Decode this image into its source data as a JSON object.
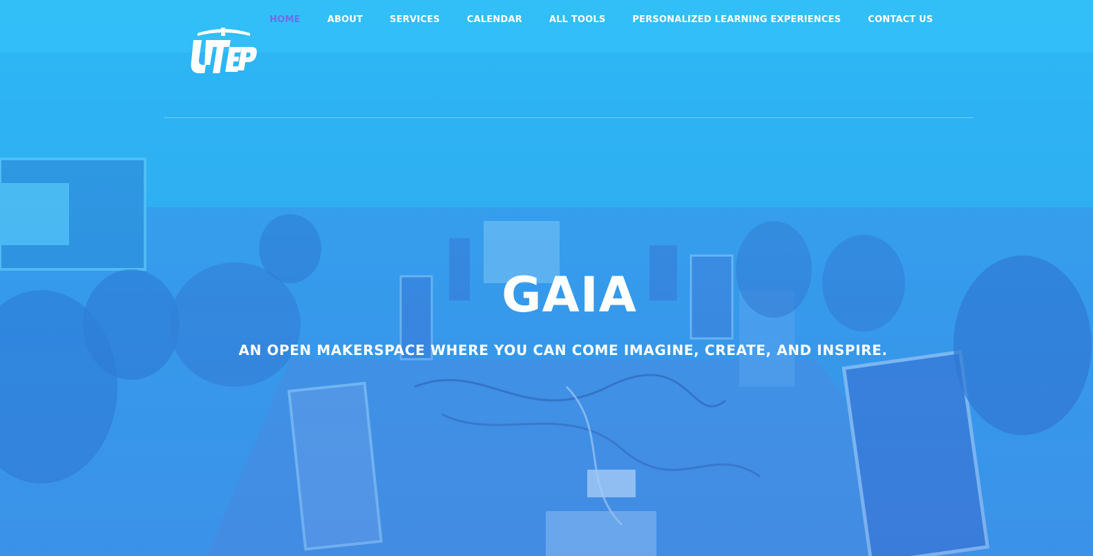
{
  "brand": {
    "logo_text": "UTEP",
    "logo_icon": "utep-pickaxe-logo"
  },
  "nav": {
    "items": [
      {
        "label": "HOME",
        "active": true
      },
      {
        "label": "ABOUT",
        "active": false
      },
      {
        "label": "SERVICES",
        "active": false
      },
      {
        "label": "CALENDAR",
        "active": false
      },
      {
        "label": "ALL TOOLS",
        "active": false
      },
      {
        "label": "PERSONALIZED LEARNING EXPERIENCES",
        "active": false
      },
      {
        "label": "CONTACT US",
        "active": false
      }
    ],
    "active_color": "#6a6ee8",
    "text_color": "#ffffff"
  },
  "hero": {
    "title": "GAIA",
    "subtitle": "AN OPEN MAKERSPACE WHERE YOU CAN COME IMAGINE, CREATE, AND INSPIRE.",
    "background_description_icon": "students-at-computers-photo"
  },
  "colors": {
    "overlay_top": "#2ab9f3",
    "overlay_bottom": "#3d8ee6"
  }
}
